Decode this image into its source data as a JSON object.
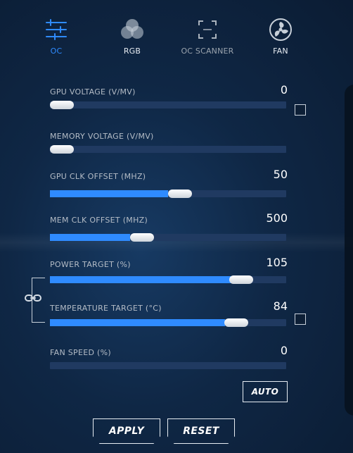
{
  "tabs": [
    {
      "label": "OC",
      "icon": "sliders-icon",
      "state": "active"
    },
    {
      "label": "RGB",
      "icon": "rgb-icon",
      "state": "normal"
    },
    {
      "label": "OC SCANNER",
      "icon": "scan-frame-icon",
      "state": "muted"
    },
    {
      "label": "FAN",
      "icon": "fan-icon",
      "state": "normal"
    }
  ],
  "controls": [
    {
      "label": "GPU VOLTAGE (V/mv)",
      "value": "0",
      "fill_percent": 0,
      "knob_percent": 5,
      "checkbox": true
    },
    {
      "label": "MEMORY VOLTAGE (V/mv)",
      "value": "",
      "fill_percent": 0,
      "knob_percent": 5,
      "checkbox": false
    },
    {
      "label": "GPU CLK OFFSET (Mhz)",
      "value": "50",
      "fill_percent": 50,
      "knob_percent": 55,
      "checkbox": false
    },
    {
      "label": "MEM CLK OFFSET (Mhz)",
      "value": "500",
      "fill_percent": 34,
      "knob_percent": 39,
      "checkbox": false
    },
    {
      "label": "POWER TARGET (%)",
      "value": "105",
      "fill_percent": 77,
      "knob_percent": 81,
      "checkbox": false
    },
    {
      "label": "TEMPERATURE TARGET (°C)",
      "value": "84",
      "fill_percent": 74,
      "knob_percent": 79,
      "checkbox": true
    },
    {
      "label": "FAN SPEED (%)",
      "value": "0",
      "fill_percent": 0,
      "knob_percent": 0,
      "checkbox": false
    }
  ],
  "buttons": {
    "auto": "AUTO",
    "apply": "APPLY",
    "reset": "RESET"
  },
  "colors": {
    "accent": "#2f8bff",
    "track": "#203a61",
    "text": "#b4bcc6"
  }
}
